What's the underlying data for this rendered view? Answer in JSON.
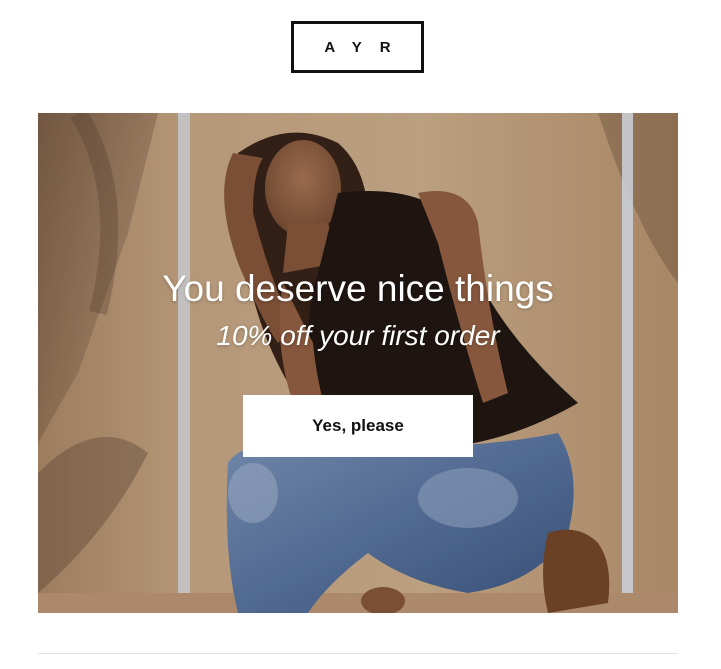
{
  "brand": {
    "logo_text": "AYR"
  },
  "hero": {
    "headline": "You deserve nice things",
    "subheadline": "10% off your first order",
    "cta_label": "Yes, please"
  },
  "colors": {
    "hero_background": "#c9a47e",
    "cta_background": "#ffffff",
    "text_on_image": "#ffffff",
    "logo_border": "#111111"
  }
}
